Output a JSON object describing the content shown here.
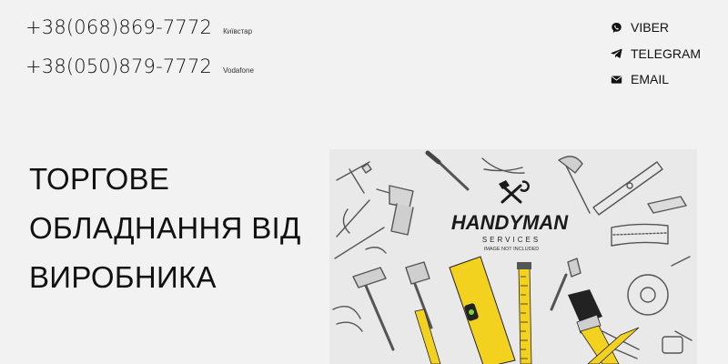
{
  "header": {
    "phones": [
      {
        "number": "+38(068)869-7772",
        "operator": "Київстар"
      },
      {
        "number": "+38(050)879-7772",
        "operator": "Vodafone"
      }
    ],
    "contacts": [
      {
        "label": "VIBER",
        "icon": "viber-icon"
      },
      {
        "label": "TELEGRAM",
        "icon": "telegram-icon"
      },
      {
        "label": "EMAIL",
        "icon": "email-icon"
      }
    ]
  },
  "hero": {
    "title_lines": [
      "ТОРГОВЕ",
      "ОБЛАДНАННЯ ВІД",
      "ВИРОБНИКА"
    ],
    "image": {
      "logo_text": "HANDYMAN",
      "logo_subtitle": "SERVICES",
      "logo_note": "IMAGE NOT INCLUDED",
      "accent_color": "#f2d21f"
    }
  }
}
